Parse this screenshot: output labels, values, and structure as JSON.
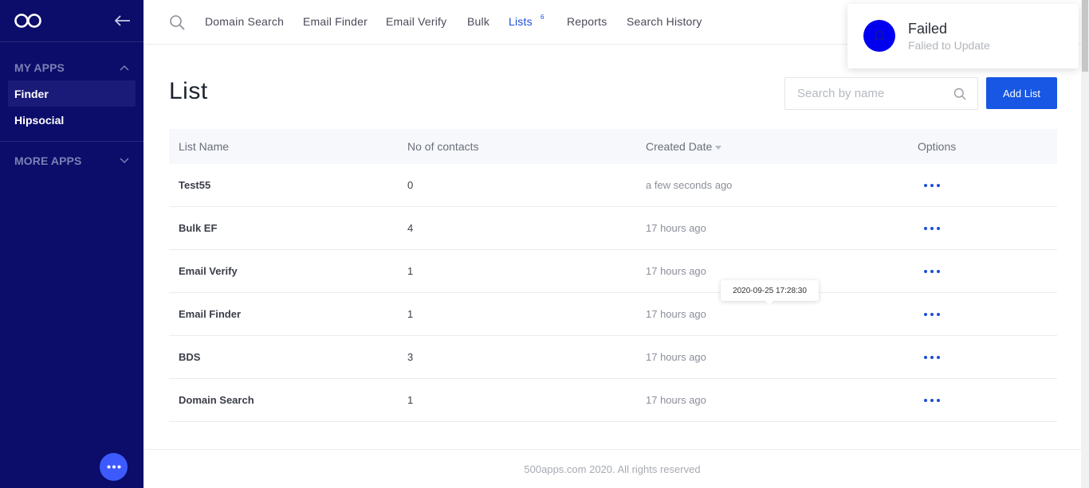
{
  "sidebar": {
    "logo_icon": "infinity-logo-icon",
    "collapse_icon": "arrow-left-icon",
    "my_apps_label": "MY APPS",
    "more_apps_label": "MORE APPS",
    "items": [
      {
        "label": "Finder",
        "active": true
      },
      {
        "label": "Hipsocial",
        "active": false
      }
    ],
    "fab_icon": "ellipsis-icon",
    "bg_color": "#0c0c6a"
  },
  "topnav": {
    "search_icon": "search-icon",
    "links": [
      {
        "label": "Domain Search"
      },
      {
        "label": "Email Finder"
      },
      {
        "label": "Email Verify"
      },
      {
        "label": "Bulk"
      },
      {
        "label": "Lists",
        "badge": "6",
        "active": true
      },
      {
        "label": "Reports"
      },
      {
        "label": "Search History"
      }
    ]
  },
  "main": {
    "title": "List",
    "search_placeholder": "Search by name",
    "add_button_label": "Add List",
    "accent_color": "#1757e3"
  },
  "table": {
    "headers": [
      "List Name",
      "No of contacts",
      "Created Date",
      "Options"
    ],
    "rows": [
      {
        "name": "Test55",
        "contacts": "0",
        "created": "a few seconds ago"
      },
      {
        "name": "Bulk EF",
        "contacts": "4",
        "created": "17 hours ago"
      },
      {
        "name": "Email Verify",
        "contacts": "1",
        "created": "17 hours ago"
      },
      {
        "name": "Email Finder",
        "contacts": "1",
        "created": "17 hours ago"
      },
      {
        "name": "BDS",
        "contacts": "3",
        "created": "17 hours ago"
      },
      {
        "name": "Domain Search",
        "contacts": "1",
        "created": "17 hours ago"
      }
    ]
  },
  "tooltip": {
    "text": "2020-09-25 17:28:30"
  },
  "toast": {
    "title": "Failed",
    "message": "Falied to Update",
    "icon": "bell-icon",
    "icon_color": "#0000ee"
  },
  "footer": {
    "text": "500apps.com 2020. All rights reserved"
  }
}
